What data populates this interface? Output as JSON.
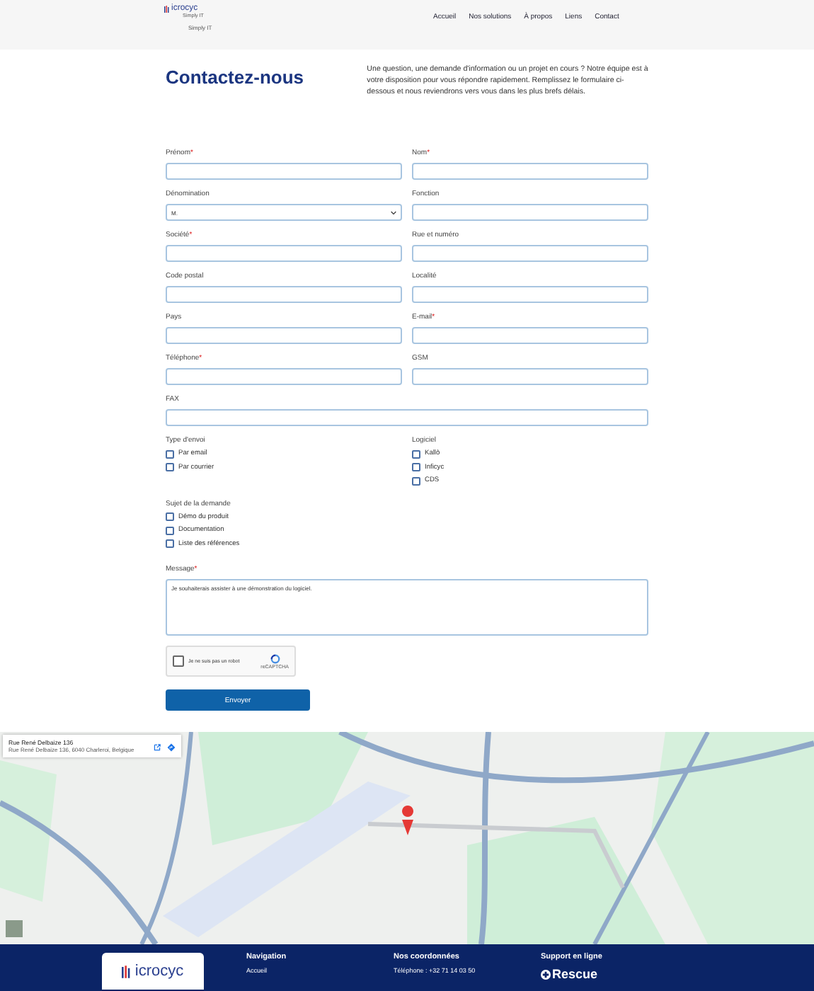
{
  "header": {
    "logo": {
      "text": "icrocyc",
      "tagline": "Simply IT"
    },
    "subtagline": "Simply IT",
    "nav": [
      {
        "label": "Accueil"
      },
      {
        "label": "Nos solutions"
      },
      {
        "label": "À propos"
      },
      {
        "label": "Liens"
      },
      {
        "label": "Contact"
      }
    ]
  },
  "intro": {
    "title": "Contactez-nous",
    "text": "Une question, une demande d'information ou un projet en cours ? Notre équipe est à votre disposition pour vous répondre rapidement. Remplissez le formulaire ci-dessous et nous reviendrons vers vous dans les plus brefs délais."
  },
  "fields": [
    {
      "label": "Prénom",
      "required_mark": "*",
      "kind": "text"
    },
    {
      "label": "Nom",
      "required_mark": "*",
      "kind": "text"
    },
    {
      "label": "Dénomination",
      "kind": "select",
      "value": "M."
    },
    {
      "label": "Fonction",
      "kind": "text"
    },
    {
      "label": "Société",
      "required_mark": "*",
      "kind": "text"
    },
    {
      "label": "Rue et numéro",
      "kind": "text"
    },
    {
      "label": "Code postal",
      "kind": "text"
    },
    {
      "label": "Localité",
      "kind": "text"
    },
    {
      "label": "Pays",
      "kind": "text"
    },
    {
      "label": "E-mail",
      "required_mark": "*",
      "kind": "text"
    },
    {
      "label": "Téléphone",
      "required_mark": "*",
      "kind": "text"
    },
    {
      "label": "GSM",
      "kind": "text"
    },
    {
      "label": "FAX",
      "kind": "wide"
    }
  ],
  "check_groups": [
    {
      "label": "Type d'envoi",
      "options": [
        {
          "label": "Par email",
          "checked": false
        },
        {
          "label": "Par courrier",
          "checked": false
        }
      ]
    },
    {
      "label": "Logiciel",
      "options": [
        {
          "label": "Kallò",
          "checked": false
        },
        {
          "label": "Inficyc",
          "checked": false
        },
        {
          "label": "CDS",
          "checked": false
        }
      ]
    },
    {
      "label": "Sujet de la demande",
      "options": [
        {
          "label": "Démo du produit",
          "checked": false
        },
        {
          "label": "Documentation",
          "checked": false
        },
        {
          "label": "Liste des références",
          "checked": false
        }
      ]
    }
  ],
  "message": {
    "label": "Message",
    "required_mark": "*",
    "value": "Je souhaiterais assister à une démonstration du logiciel."
  },
  "captcha": {
    "label": "Je ne suis pas un robot",
    "checked": false,
    "brand": "reCAPTCHA"
  },
  "submit": "Envoyer",
  "map": {
    "kind": "picture",
    "place_card": {
      "title": "Rue René Delbaize 136",
      "address": "Rue René Delbaize 136, 6040 Charleroi, Belgique"
    }
  },
  "footer": {
    "logo": "icrocyc",
    "columns": [
      {
        "heading": "Navigation",
        "items": [
          "Accueil"
        ]
      },
      {
        "heading": "Nos coordonnées",
        "items": [
          "Téléphone : +32 71 14 03 50"
        ]
      },
      {
        "heading": "Support en ligne",
        "brand": "Rescue"
      }
    ]
  }
}
